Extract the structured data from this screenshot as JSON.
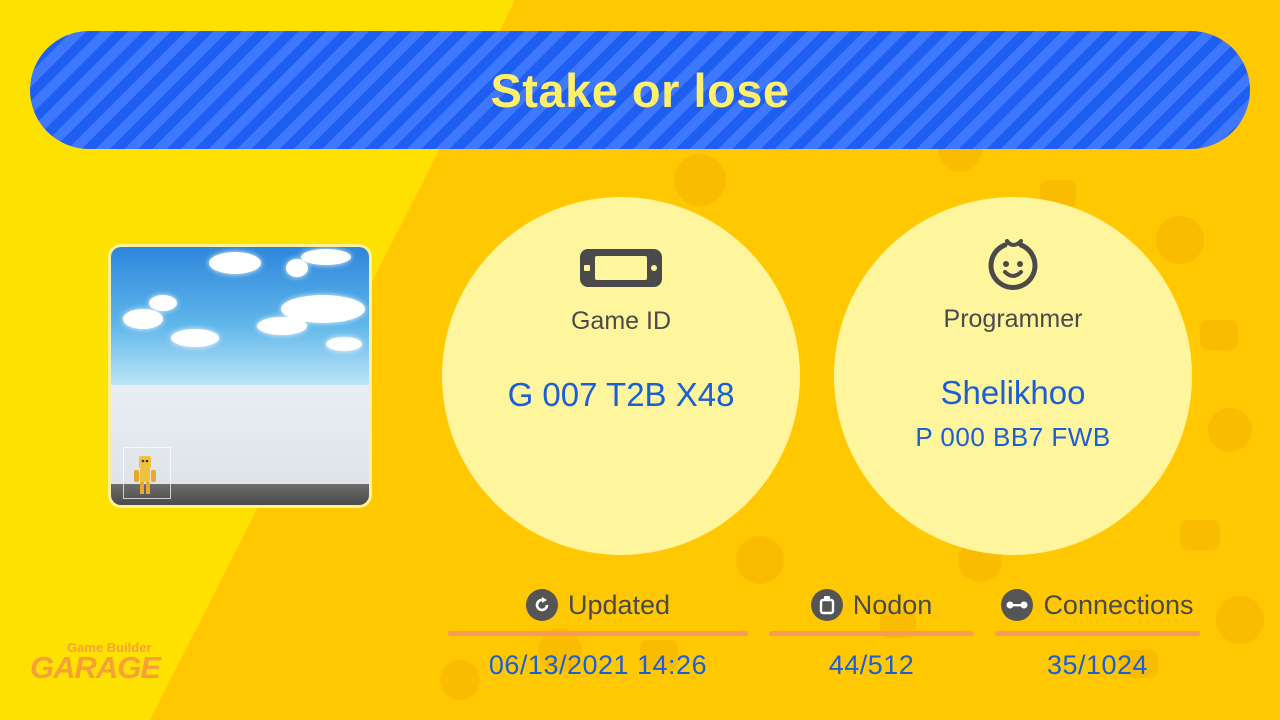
{
  "header": {
    "title": "Stake or lose"
  },
  "game_info": {
    "label": "Game ID",
    "value": "G 007 T2B X48",
    "icon": "console-icon"
  },
  "programmer_info": {
    "label": "Programmer",
    "name": "Shelikhoo",
    "id": "P 000 BB7 FWB",
    "icon": "face-icon"
  },
  "stats": {
    "updated": {
      "label": "Updated",
      "value": "06/13/2021 14:26",
      "icon": "refresh-icon"
    },
    "nodon": {
      "label": "Nodon",
      "value": "44/512",
      "icon": "nodon-icon"
    },
    "connections": {
      "label": "Connections",
      "value": "35/1024",
      "icon": "connection-icon"
    }
  },
  "logo": {
    "small": "Game Builder",
    "big": "GARAGE"
  },
  "colors": {
    "background": "#ffe100",
    "background_alt": "#ffc800",
    "title_bar": "#1f5ef2",
    "title_text": "#fff06a",
    "circle": "#fff59d",
    "value_text": "#1a5fd6",
    "rule": "#f79a5c",
    "logo": "#f6a03a"
  }
}
